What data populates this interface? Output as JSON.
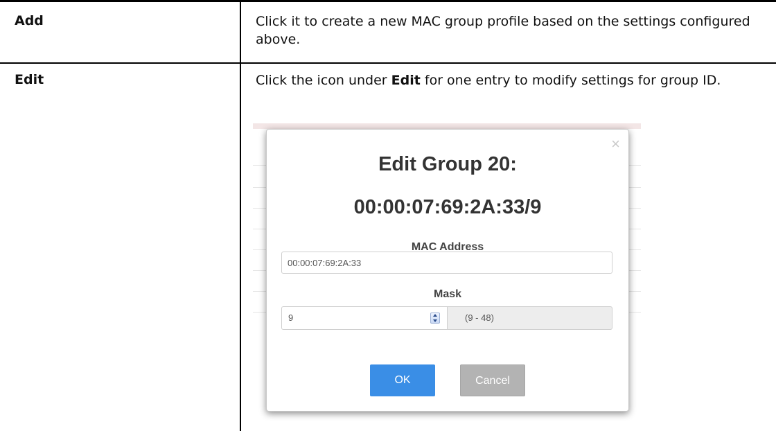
{
  "rows": [
    {
      "term": "Add",
      "desc": "Click it to create a new MAC group profile based on the settings configured above."
    },
    {
      "term": "Edit",
      "desc_before": "Click the icon under ",
      "desc_bold": "Edit",
      "desc_after": " for one entry to modify settings for group ID."
    }
  ],
  "dialog": {
    "close_glyph": "×",
    "title": "Edit Group 20:",
    "subtitle": "00:00:07:69:2A:33/9",
    "mac_label": "MAC Address",
    "mac_value": "00:00:07:69:2A:33",
    "mask_label": "Mask",
    "mask_value": "9",
    "mask_range": "(9 - 48)",
    "ok_label": "OK",
    "cancel_label": "Cancel"
  },
  "colors": {
    "primary": "#3a8ee6",
    "secondary": "#b3b3b3"
  }
}
